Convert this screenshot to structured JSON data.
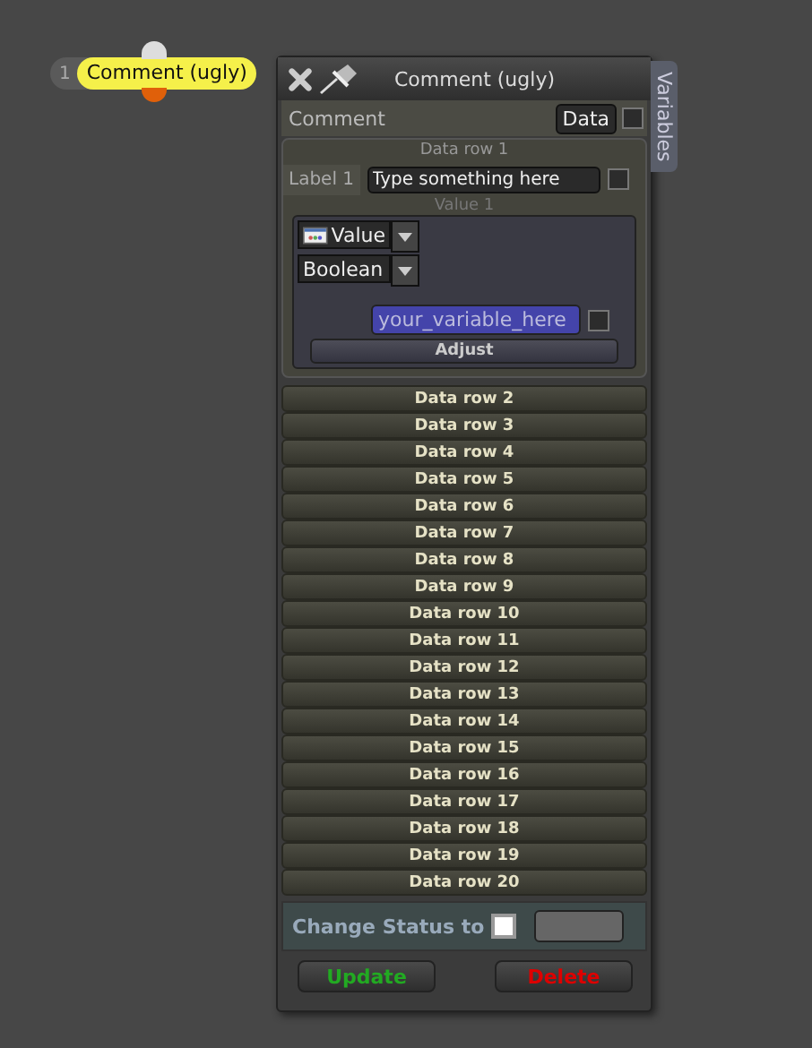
{
  "node": {
    "index": "1",
    "label": "Comment (ugly)"
  },
  "panel": {
    "title": "Comment (ugly)",
    "side_tab": "Variables",
    "comment_label": "Comment",
    "data_button": "Data",
    "data_checkbox": {
      "checked": false
    },
    "rows": [
      {
        "title": "Data row 1",
        "expanded": true,
        "label": "Label 1",
        "input_value": "Type something here",
        "checkbox": {
          "checked": false
        },
        "value_caption": "Value 1",
        "type_dropdown": "Value",
        "format_dropdown": "Boolean",
        "variable_value": "your_variable_here",
        "variable_checkbox": {
          "checked": false
        },
        "adjust_button": "Adjust"
      },
      {
        "title": "Data row 2",
        "expanded": false
      },
      {
        "title": "Data row 3",
        "expanded": false
      },
      {
        "title": "Data row 4",
        "expanded": false
      },
      {
        "title": "Data row 5",
        "expanded": false
      },
      {
        "title": "Data row 6",
        "expanded": false
      },
      {
        "title": "Data row 7",
        "expanded": false
      },
      {
        "title": "Data row 8",
        "expanded": false
      },
      {
        "title": "Data row 9",
        "expanded": false
      },
      {
        "title": "Data row 10",
        "expanded": false
      },
      {
        "title": "Data row 11",
        "expanded": false
      },
      {
        "title": "Data row 12",
        "expanded": false
      },
      {
        "title": "Data row 13",
        "expanded": false
      },
      {
        "title": "Data row 14",
        "expanded": false
      },
      {
        "title": "Data row 15",
        "expanded": false
      },
      {
        "title": "Data row 16",
        "expanded": false
      },
      {
        "title": "Data row 17",
        "expanded": false
      },
      {
        "title": "Data row 18",
        "expanded": false
      },
      {
        "title": "Data row 19",
        "expanded": false
      },
      {
        "title": "Data row 20",
        "expanded": false
      }
    ],
    "status_label": "Change Status to",
    "status_checkbox": {
      "checked": false
    },
    "buttons": [
      {
        "label": "Update",
        "kind": "update"
      },
      {
        "label": "Delete",
        "kind": "delete"
      }
    ]
  }
}
